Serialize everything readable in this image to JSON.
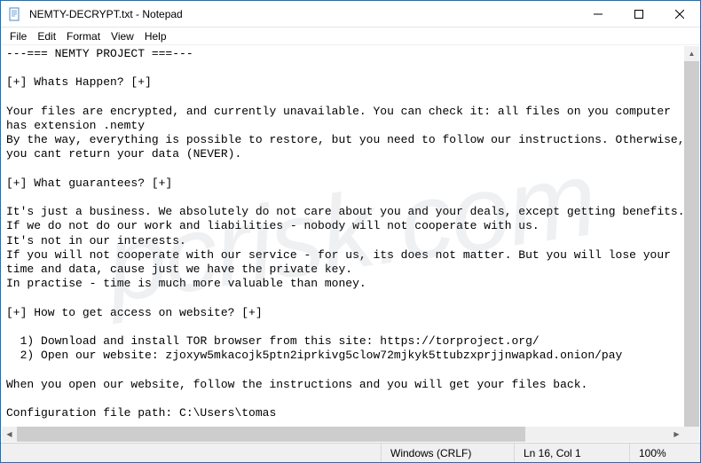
{
  "window": {
    "title": "NEMTY-DECRYPT.txt - Notepad"
  },
  "menu": {
    "file": "File",
    "edit": "Edit",
    "format": "Format",
    "view": "View",
    "help": "Help"
  },
  "body": {
    "text": "---=== NEMTY PROJECT ===---\n\n[+] Whats Happen? [+]\n\nYour files are encrypted, and currently unavailable. You can check it: all files on you computer has extension .nemty\nBy the way, everything is possible to restore, but you need to follow our instructions. Otherwise, you cant return your data (NEVER).\n\n[+] What guarantees? [+]\n\nIt's just a business. We absolutely do not care about you and your deals, except getting benefits.\nIf we do not do our work and liabilities - nobody will not cooperate with us.\nIt's not in our interests.\nIf you will not cooperate with our service - for us, its does not matter. But you will lose your time and data, cause just we have the private key.\nIn practise - time is much more valuable than money.\n\n[+] How to get access on website? [+]\n\n  1) Download and install TOR browser from this site: https://torproject.org/\n  2) Open our website: zjoxyw5mkacojk5ptn2iprkivg5clow72mjkyk5ttubzxprjjnwapkad.onion/pay\n\nWhen you open our website, follow the instructions and you will get your files back.\n\nConfiguration file path: C:\\Users\\tomas"
  },
  "status": {
    "encoding": "Windows (CRLF)",
    "position": "Ln 16, Col 1",
    "zoom": "100%"
  }
}
